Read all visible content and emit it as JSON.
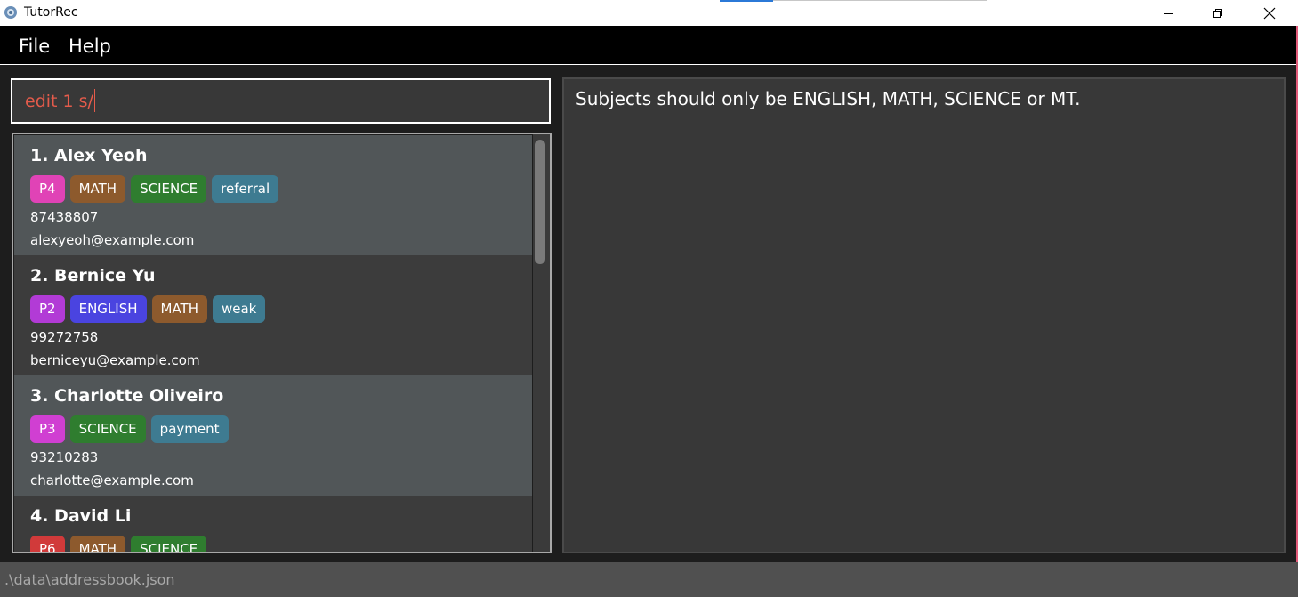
{
  "window": {
    "title": "TutorRec"
  },
  "menu": {
    "items": [
      {
        "label": "File"
      },
      {
        "label": "Help"
      }
    ]
  },
  "command": {
    "value": "edit 1 s/"
  },
  "result": {
    "message": "Subjects should only be ENGLISH, MATH, SCIENCE or MT."
  },
  "persons": [
    {
      "index_name": "1.  Alex Yeoh",
      "tags": [
        {
          "label": "P4",
          "color": "#e043b6"
        },
        {
          "label": "MATH",
          "color": "#8d5a2d"
        },
        {
          "label": "SCIENCE",
          "color": "#2f7d2f"
        },
        {
          "label": "referral",
          "color": "#3e7b91"
        }
      ],
      "phone": "87438807",
      "email": "alexyeoh@example.com"
    },
    {
      "index_name": "2.  Bernice Yu",
      "tags": [
        {
          "label": "P2",
          "color": "#b23bd6"
        },
        {
          "label": "ENGLISH",
          "color": "#4a44e0"
        },
        {
          "label": "MATH",
          "color": "#8d5a2d"
        },
        {
          "label": "weak",
          "color": "#3e7b91"
        }
      ],
      "phone": "99272758",
      "email": "berniceyu@example.com"
    },
    {
      "index_name": "3.  Charlotte Oliveiro",
      "tags": [
        {
          "label": "P3",
          "color": "#d03fd2"
        },
        {
          "label": "SCIENCE",
          "color": "#2f7d2f"
        },
        {
          "label": "payment",
          "color": "#3e7b91"
        }
      ],
      "phone": "93210283",
      "email": "charlotte@example.com"
    },
    {
      "index_name": "4.  David Li",
      "tags": [
        {
          "label": "P6",
          "color": "#d13a3a"
        },
        {
          "label": "MATH",
          "color": "#8d5a2d"
        },
        {
          "label": "SCIENCE",
          "color": "#2f7d2f"
        }
      ],
      "phone": "",
      "email": ""
    }
  ],
  "status": {
    "path": ".\\data\\addressbook.json"
  },
  "colors": {
    "command_text": "#e45b4b",
    "card_odd": "#515658",
    "card_even": "#3c3c3c"
  }
}
